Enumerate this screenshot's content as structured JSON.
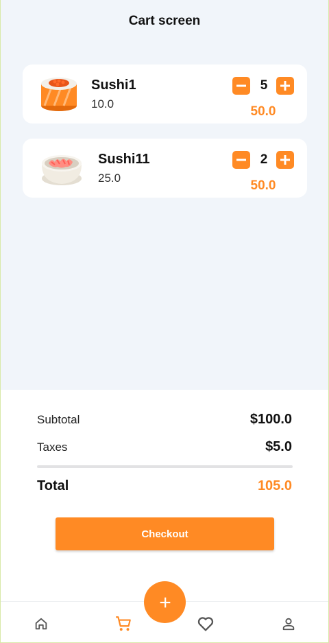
{
  "header": {
    "title": "Cart screen"
  },
  "cart": {
    "items": [
      {
        "name": "Sushi1",
        "unit_price": "10.0",
        "quantity": "5",
        "line_total": "50.0",
        "image": "sushi-roll-image"
      },
      {
        "name": "Sushi11",
        "unit_price": "25.0",
        "quantity": "2",
        "line_total": "50.0",
        "image": "sushi-bowl-image"
      }
    ]
  },
  "summary": {
    "subtotal_label": "Subtotal",
    "subtotal_value": "$100.0",
    "taxes_label": "Taxes",
    "taxes_value": "$5.0",
    "total_label": "Total",
    "total_value": "105.0"
  },
  "checkout": {
    "label": "Checkout"
  },
  "nav": {
    "items": [
      {
        "icon": "home-icon",
        "active": false
      },
      {
        "icon": "cart-icon",
        "active": true
      },
      {
        "icon": "heart-icon",
        "active": false
      },
      {
        "icon": "person-icon",
        "active": false
      }
    ],
    "fab_icon": "plus-icon"
  },
  "colors": {
    "accent": "#ff8a24",
    "background": "#f1f5fa",
    "card": "#ffffff"
  }
}
